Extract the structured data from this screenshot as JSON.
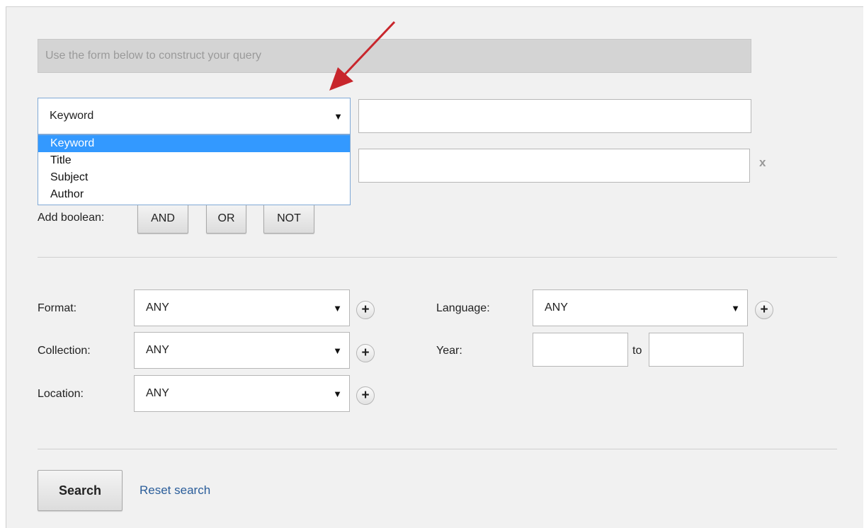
{
  "query_hint": "Use the form below to construct your query",
  "row1": {
    "field_select": "Keyword"
  },
  "dropdown": {
    "options": [
      "Keyword",
      "Title",
      "Subject",
      "Author"
    ],
    "selected": "Keyword"
  },
  "row2": {
    "remove_label": "x"
  },
  "boolean": {
    "label": "Add boolean:",
    "and": "AND",
    "or": "OR",
    "not": "NOT"
  },
  "filters": {
    "format": {
      "label": "Format:",
      "value": "ANY"
    },
    "collection": {
      "label": "Collection:",
      "value": "ANY"
    },
    "location": {
      "label": "Location:",
      "value": "ANY"
    },
    "language": {
      "label": "Language:",
      "value": "ANY"
    },
    "year": {
      "label": "Year:",
      "to": "to"
    }
  },
  "icons": {
    "caret": "▼",
    "plus": "+"
  },
  "actions": {
    "search": "Search",
    "reset": "Reset search"
  },
  "colors": {
    "highlight": "#3399ff",
    "arrow": "#c8262c",
    "link": "#2a5d9a"
  }
}
